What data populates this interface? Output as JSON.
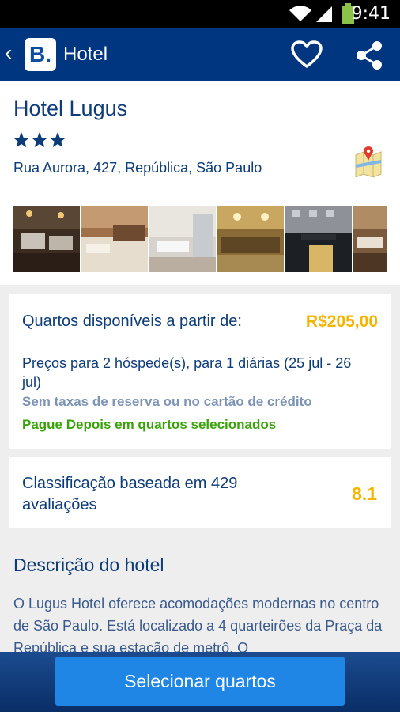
{
  "status_bar": {
    "time": "9:41"
  },
  "app_bar": {
    "back_icon": "chevron-left-icon",
    "logo_letter": "B.",
    "title": "Hotel",
    "favorite_icon": "heart-icon",
    "share_icon": "share-icon"
  },
  "hotel": {
    "name": "Hotel Lugus",
    "stars": 3,
    "address": "Rua Aurora, 427, República, São Paulo",
    "map_icon": "map-icon",
    "photos": [
      "restaurant",
      "bedroom",
      "bathroom",
      "lobby",
      "facade",
      "dining-room"
    ]
  },
  "availability": {
    "label": "Quartos disponíveis a partir de:",
    "price": "R$205,00",
    "price_info": "Preços para 2 hóspede(s), para 1 diárias (25 jul - 26 jul)",
    "no_fees": "Sem taxas de reserva ou no cartão de crédito",
    "pay_later": "Pague Depois em quartos selecionados"
  },
  "rating": {
    "label": "Classificação baseada em 429 avaliações",
    "score": "8.1"
  },
  "description": {
    "title": "Descrição do hotel",
    "text": "O Lugus Hotel oferece acomodações modernas no centro de São Paulo. Está localizado a 4 quarteirões da Praça da República e sua estação de metrô. O"
  },
  "bottom": {
    "select_button": "Selecionar quartos"
  },
  "colors": {
    "brand": "#003580",
    "price": "#f4b400",
    "pay_later": "#3aa30b",
    "button": "#1f86e6"
  }
}
